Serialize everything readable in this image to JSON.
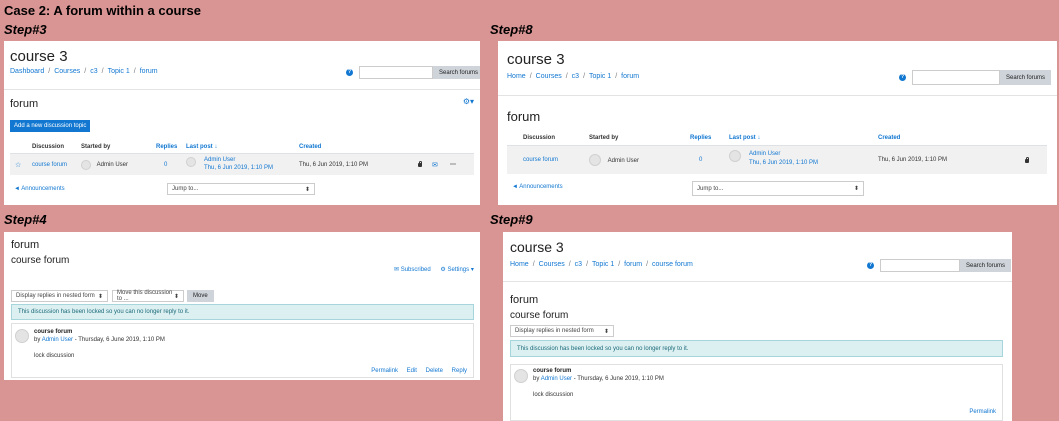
{
  "case_title": "Case 2: A forum within a course",
  "steps": [
    "Step#3",
    "Step#8",
    "Step#4",
    "Step#9"
  ],
  "step3": {
    "course_title": "course 3",
    "breadcrumb": [
      "Dashboard",
      "Courses",
      "c3",
      "Topic 1",
      "forum"
    ],
    "search_button": "Search forums",
    "forum_title": "forum",
    "add_button": "Add a new discussion topic",
    "columns": [
      "Discussion",
      "Started by",
      "Replies",
      "Last post",
      "Created"
    ],
    "row": {
      "discussion": "course forum",
      "started_by": "Admin User",
      "replies": "0",
      "last_post_user": "Admin User",
      "last_post_date": "Thu, 6 Jun 2019, 1:10 PM",
      "created": "Thu, 6 Jun 2019, 1:10 PM"
    },
    "prev_link": "◄ Announcements",
    "jump_to": "Jump to..."
  },
  "step8": {
    "course_title": "course 3",
    "breadcrumb": [
      "Home",
      "Courses",
      "c3",
      "Topic 1",
      "forum"
    ],
    "search_button": "Search forums",
    "forum_title": "forum",
    "columns": [
      "Discussion",
      "Started by",
      "Replies",
      "Last post",
      "Created"
    ],
    "row": {
      "discussion": "course forum",
      "started_by": "Admin User",
      "replies": "0",
      "last_post_user": "Admin User",
      "last_post_date": "Thu, 6 Jun 2019, 1:10 PM",
      "created": "Thu, 6 Jun 2019, 1:10 PM"
    },
    "prev_link": "◄ Announcements",
    "jump_to": "Jump to..."
  },
  "step4": {
    "forum_title": "forum",
    "discussion_title": "course forum",
    "subscribed": "Subscribed",
    "settings": "Settings",
    "display_mode": "Display replies in nested form",
    "move_select": "Move this discussion to ...",
    "move_button": "Move",
    "alert": "This discussion has been locked so you can no longer reply to it.",
    "post_subject": "course forum",
    "post_by": "by",
    "post_author": "Admin User",
    "post_date": "- Thursday, 6 June 2019, 1:10 PM",
    "post_body": "lock discussion",
    "actions": [
      "Permalink",
      "Edit",
      "Delete",
      "Reply"
    ]
  },
  "step9": {
    "course_title": "course 3",
    "breadcrumb": [
      "Home",
      "Courses",
      "c3",
      "Topic 1",
      "forum",
      "course forum"
    ],
    "search_button": "Search forums",
    "forum_title": "forum",
    "discussion_title": "course forum",
    "display_mode": "Display replies in nested form",
    "alert": "This discussion has been locked so you can no longer reply to it.",
    "post_subject": "course forum",
    "post_by": "by",
    "post_author": "Admin User",
    "post_date": "- Thursday, 6 June 2019, 1:10 PM",
    "post_body": "lock discussion",
    "permalink": "Permalink"
  }
}
